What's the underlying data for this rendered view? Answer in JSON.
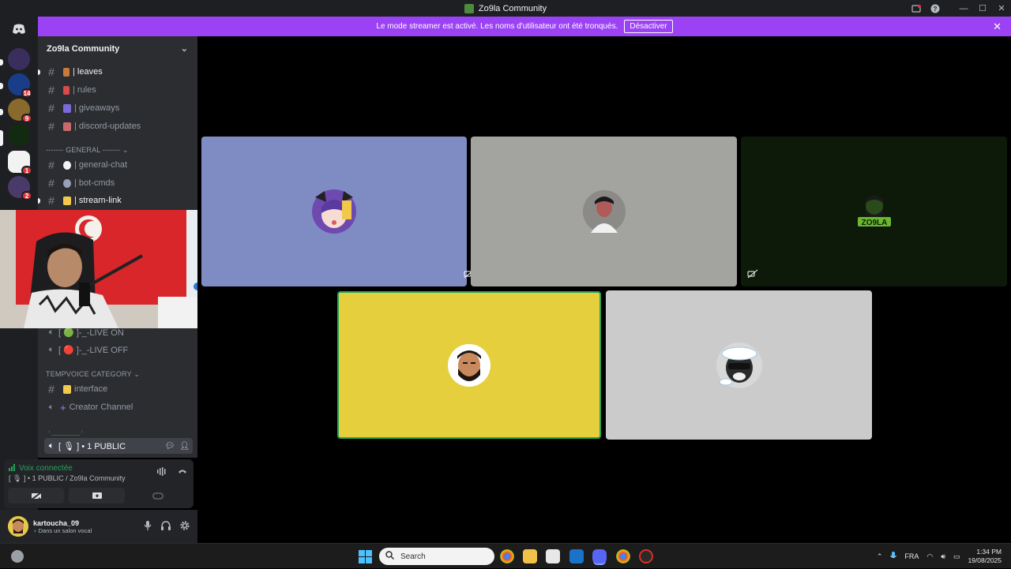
{
  "window": {
    "title": "Zo9la Community"
  },
  "banner": {
    "text": "Le mode streamer est activé. Les noms d'utilisateur ont été tronqués.",
    "button": "Désactiver"
  },
  "server": {
    "name": "Zo9la Community"
  },
  "rail_badges": [
    "14",
    "9",
    "1",
    "2"
  ],
  "channels": {
    "top": [
      {
        "label": "| leaves",
        "bold": true
      },
      {
        "label": "| rules",
        "bold": false
      },
      {
        "label": "| giveaways",
        "bold": false
      },
      {
        "label": "| discord-updates",
        "bold": false
      }
    ],
    "general_category": "------- GENERAL -------",
    "general": [
      {
        "label": "| general-chat"
      },
      {
        "label": "| bot-cmds"
      },
      {
        "label": "| stream-link"
      }
    ],
    "live_on": "[ 🟢 ]-_-LIVE ON",
    "live_off": "[ 🔴 ]-_-LIVE OFF",
    "tempvoice_category": "TEMPVOICE CATEGORY",
    "interface": "interface",
    "creator": "Creator Channel",
    "divider": "ᵎ ________ ᵎ",
    "public_voice": "[ 🎙 ] • 1 PUBLIC"
  },
  "voice": {
    "status": "Voix connectée",
    "sub": "[ 🎙 ] • 1 PUBLIC / Zo9la Community"
  },
  "user": {
    "name": "kartoucha_09",
    "status": "Dans un salon vocal"
  },
  "taskbar": {
    "search_placeholder": "Search",
    "lang": "FRA",
    "time": "1:34 PM",
    "date": "19/08/2025"
  },
  "tiles": [
    {
      "name": "tile-1",
      "color": "#7f8bc3"
    },
    {
      "name": "tile-2",
      "color": "#a3a39f"
    },
    {
      "name": "tile-3",
      "color": "#0d1a0a"
    },
    {
      "name": "tile-4",
      "color": "#e5cf3d"
    },
    {
      "name": "tile-5",
      "color": "#cbcbcb"
    }
  ],
  "icons": {
    "discord": "discord-icon",
    "screen_share": "screen-share-icon",
    "settings": "gear-icon"
  }
}
